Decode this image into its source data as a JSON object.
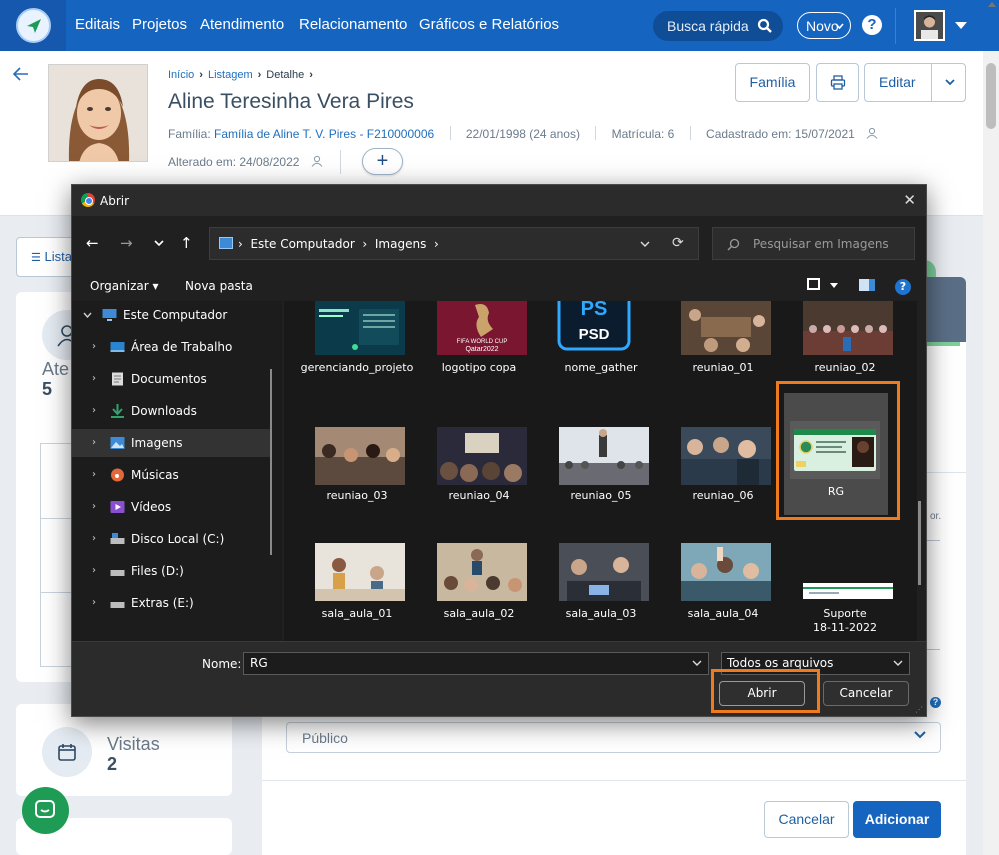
{
  "nav": {
    "links": [
      "Editais",
      "Projetos",
      "Atendimento",
      "Relacionamento",
      "Gráficos e Relatórios"
    ],
    "quick_search": "Busca rápida",
    "new_label": "Novo",
    "help": "?"
  },
  "header": {
    "breadcrumb": [
      "Início",
      "Listagem",
      "Detalhe"
    ],
    "name": "Aline Teresinha Vera Pires",
    "family_prefix": "Família:",
    "family_link": "Família de Aline T. V. Pires - F210000006",
    "birth": "22/01/1998 (24 anos)",
    "enrollment": "Matrícula: 6",
    "registered": "Cadastrado em: 15/07/2021",
    "changed": "Alterado em: 24/08/2022",
    "plus": "+",
    "buttons": {
      "family": "Família",
      "edit": "Editar"
    }
  },
  "left": {
    "list_button": "Lista",
    "stat1_label": "Ate",
    "stat1_value": "5",
    "visits_label": "Visitas",
    "visits_value": "2"
  },
  "panel": {
    "truncated_text": "or.",
    "publico_placeholder": "Público",
    "cancel": "Cancelar",
    "add": "Adicionar"
  },
  "dialog": {
    "title": "Abrir",
    "path": [
      "Este Computador",
      "Imagens"
    ],
    "search_placeholder": "Pesquisar em Imagens",
    "organize": "Organizar",
    "new_folder": "Nova pasta",
    "help": "?",
    "tree": [
      {
        "label": "Este Computador",
        "icon": "computer-icon",
        "expanded": true
      },
      {
        "label": "Área de Trabalho",
        "icon": "desktop-icon"
      },
      {
        "label": "Documentos",
        "icon": "documents-icon"
      },
      {
        "label": "Downloads",
        "icon": "download-icon"
      },
      {
        "label": "Imagens",
        "icon": "pictures-icon",
        "selected": true
      },
      {
        "label": "Músicas",
        "icon": "music-icon"
      },
      {
        "label": "Vídeos",
        "icon": "video-icon"
      },
      {
        "label": "Disco Local (C:)",
        "icon": "drive-icon"
      },
      {
        "label": "Files (D:)",
        "icon": "drive-icon"
      },
      {
        "label": "Extras (E:)",
        "icon": "drive-icon"
      }
    ],
    "files_row1": [
      "gerenciando_projeto",
      "logotipo copa",
      "nome_gather",
      "reuniao_01",
      "reuniao_02"
    ],
    "files_row2": [
      "reuniao_03",
      "reuniao_04",
      "reuniao_05",
      "reuniao_06",
      "RG"
    ],
    "files_row3": [
      "sala_aula_01",
      "sala_aula_02",
      "sala_aula_03",
      "sala_aula_04",
      "Suporte\n18-11-2022"
    ],
    "thumb_texts": {
      "psd": "PSD",
      "ps": "PS",
      "fifa": "FIFA WORLD CUP",
      "qatar": "Qatar2022"
    },
    "name_label": "Nome:",
    "name_value": "RG",
    "file_type": "Todos os arquivos",
    "open": "Abrir",
    "cancel": "Cancelar"
  },
  "colors": {
    "nav_blue": "#1565c0",
    "highlight_orange": "#f07b1e",
    "chat_green": "#1e9b55",
    "dialog_bg": "#202020"
  }
}
